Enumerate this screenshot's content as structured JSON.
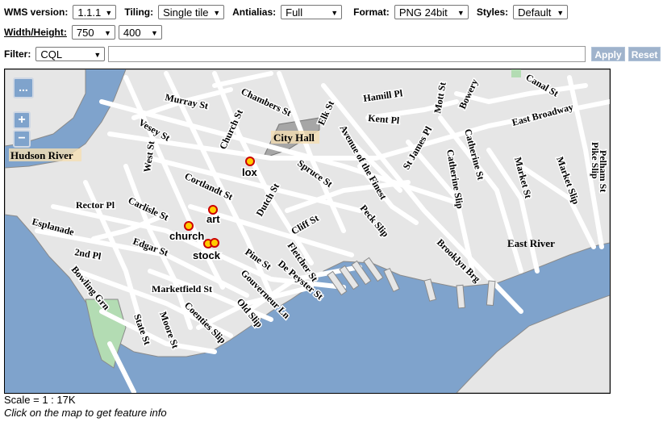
{
  "toolbar": {
    "wms_version": {
      "label": "WMS version:",
      "value": "1.1.1"
    },
    "tiling": {
      "label": "Tiling:",
      "value": "Single tile"
    },
    "antialias": {
      "label": "Antialias:",
      "value": "Full"
    },
    "format": {
      "label": "Format:",
      "value": "PNG 24bit"
    },
    "styles": {
      "label": "Styles:",
      "value": "Default"
    },
    "width_height": {
      "label": "Width/Height:",
      "width": "750",
      "height": "400"
    },
    "filter": {
      "label": "Filter:",
      "value": "CQL",
      "text": ""
    },
    "apply_label": "Apply",
    "reset_label": "Reset"
  },
  "map": {
    "layer_switcher_icon": "...",
    "zoom_in": "+",
    "zoom_out": "−",
    "water_labels": [
      "Hudson River",
      "East River"
    ],
    "landmark": "City Hall",
    "streets": [
      "Murray St",
      "Chambers St",
      "Hamill Pl",
      "Mott St",
      "Bowery",
      "Canal St",
      "Vesey St",
      "Church St",
      "Elk St",
      "Kent Pl",
      "East Broadway",
      "West St",
      "Avenue of the Finest",
      "St James Pl",
      "Catherine St",
      "Catherine Slip",
      "Market St",
      "Market Slip",
      "Pike Slip",
      "Pelham St",
      "Cortlandt St",
      "Spruce St",
      "Dutch St",
      "Rector Pl",
      "Carlisle St",
      "Cliff St",
      "Peck Slip",
      "Brooklyn Brg",
      "Esplanade",
      "Edgar St",
      "2nd Pl",
      "Pine St",
      "Fletcher St",
      "De Peyster St",
      "Bowling Grn",
      "Marketfield St",
      "Gouverneur Ln",
      "Old Slip",
      "Coenties Slip",
      "Moore St",
      "State St"
    ],
    "points": [
      "lox",
      "art",
      "church",
      "stock"
    ],
    "colors": {
      "water": "#7fa3cc",
      "land": "#e6e6e6",
      "park": "#b3dcb3",
      "landmark": "#a6a6a6",
      "road": "#ffffff",
      "point": "#ffcc00",
      "point_outline": "#cc0000"
    }
  },
  "footer": {
    "scale": "Scale = 1 : 17K",
    "hint": "Click on the map to get feature info"
  }
}
